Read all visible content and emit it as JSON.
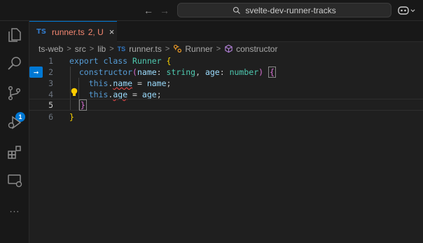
{
  "titlebar": {
    "search_text": "svelte-dev-runner-tracks",
    "back_icon": "arrow-left-icon",
    "forward_icon": "arrow-right-icon",
    "search_icon": "search-icon",
    "copilot_icon": "copilot-icon"
  },
  "activity": {
    "items": [
      "explorer-icon",
      "search-icon",
      "source-control-icon",
      "run-debug-icon",
      "extensions-icon",
      "remote-explorer-icon",
      "more-icon"
    ],
    "source_control_badge": "1",
    "more_label": "..."
  },
  "tab": {
    "lang": "TS",
    "name": "runner.ts",
    "status": "2, U",
    "close": "×"
  },
  "breadcrumbs": {
    "items": [
      "ts-web",
      "src",
      "lib",
      "runner.ts",
      "Runner",
      "constructor"
    ],
    "ts_label": "TS"
  },
  "editor": {
    "line_numbers": [
      "1",
      "2",
      "3",
      "4",
      "5",
      "6"
    ],
    "lines": {
      "l1": {
        "export": "export",
        "class": "class",
        "name": "Runner",
        "brace": "{"
      },
      "l2": {
        "ctor": "constructor",
        "p1": "name",
        "t1": "string",
        "p2": "age",
        "t2": "number",
        "brace": "{"
      },
      "l3": {
        "this": "this",
        "prop": "name",
        "rhs": "name"
      },
      "l4": {
        "this": "this",
        "prop": "age",
        "rhs": "age"
      },
      "l5": {
        "brace": "}"
      },
      "l6": {
        "brace": "}"
      }
    },
    "gutter_arrow": "→"
  },
  "colors": {
    "accent": "#0078d4",
    "error": "#f48771",
    "keyword": "#569cd6",
    "type": "#4ec9b0"
  }
}
